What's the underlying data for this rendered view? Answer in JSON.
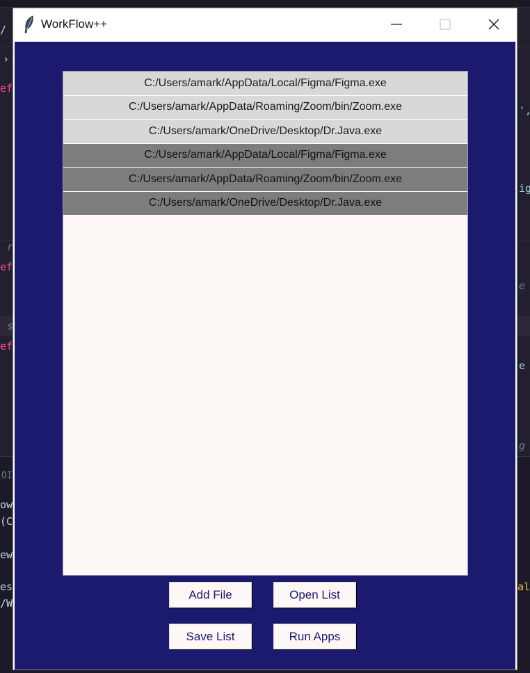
{
  "window": {
    "title": "WorkFlow++",
    "icon": "feather-icon",
    "controls": {
      "minimize": "minimize-icon",
      "maximize": "maximize-icon",
      "close": "close-icon"
    }
  },
  "background_editor": {
    "fragments": [
      "ef",
      "ef",
      "ef",
      "r",
      "s",
      "ig",
      "e",
      "e",
      "g",
      "',",
      "OI",
      "owe",
      "(C",
      "ew",
      "es\\",
      "/W",
      "al"
    ]
  },
  "file_list": {
    "items": [
      {
        "path": "C:/Users/amark/AppData/Local/Figma/Figma.exe",
        "style": "light"
      },
      {
        "path": "C:/Users/amark/AppData/Roaming/Zoom/bin/Zoom.exe",
        "style": "light"
      },
      {
        "path": "C:/Users/amark/OneDrive/Desktop/Dr.Java.exe",
        "style": "light"
      },
      {
        "path": "C:/Users/amark/AppData/Local/Figma/Figma.exe",
        "style": "dark"
      },
      {
        "path": "C:/Users/amark/AppData/Roaming/Zoom/bin/Zoom.exe",
        "style": "dark"
      },
      {
        "path": "C:/Users/amark/OneDrive/Desktop/Dr.Java.exe",
        "style": "dark"
      }
    ]
  },
  "buttons": {
    "add_file": "Add File",
    "open_list": "Open List",
    "save_list": "Save List",
    "run_apps": "Run Apps"
  },
  "colors": {
    "client_bg": "#1b1a6e",
    "list_bg": "#fdf8f6",
    "item_light": "#d8d8d8",
    "item_dark": "#7d7d7d",
    "button_text": "#1b1a6e"
  }
}
